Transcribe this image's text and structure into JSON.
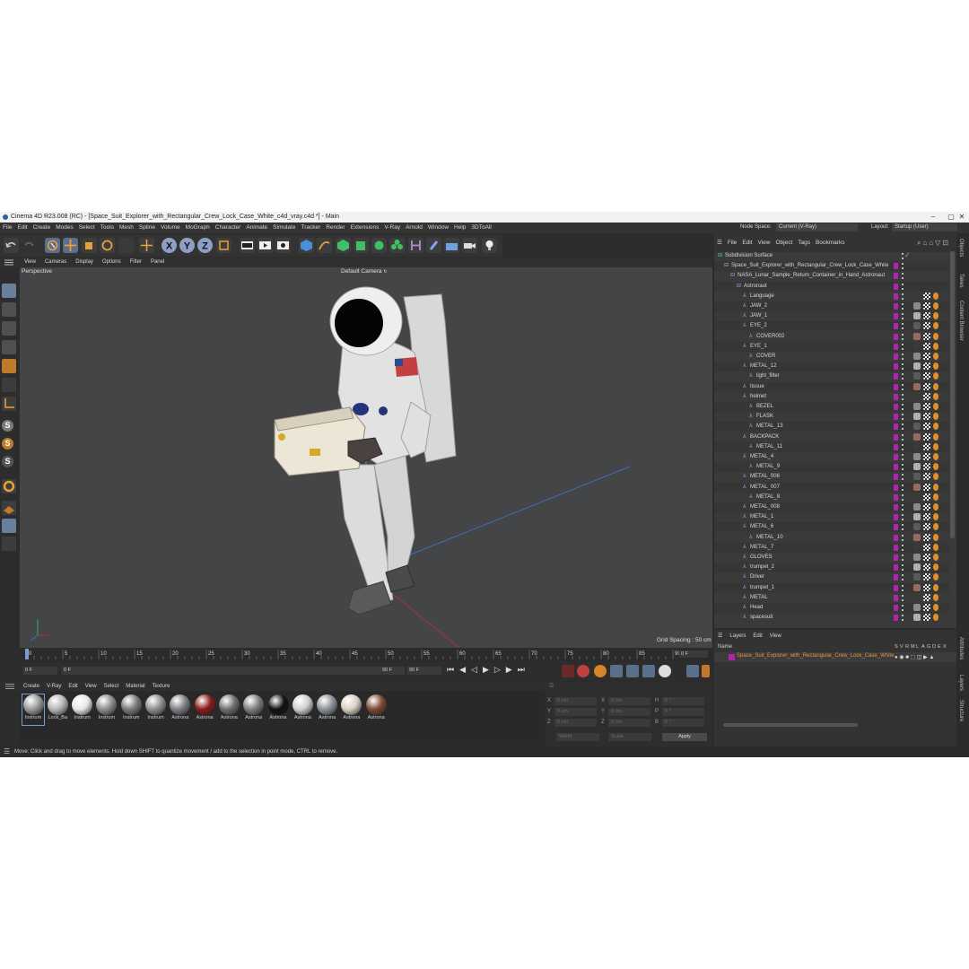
{
  "window": {
    "title": "Cinema 4D R23.008 (RC) - [Space_Suit_Explorer_with_Rectangular_Crew_Lock_Case_White_c4d_vray.c4d *] - Main"
  },
  "menubar": [
    "File",
    "Edit",
    "Create",
    "Modes",
    "Select",
    "Tools",
    "Mesh",
    "Spline",
    "Volume",
    "MoGraph",
    "Character",
    "Animate",
    "Simulate",
    "Tracker",
    "Render",
    "Extensions",
    "V-Ray",
    "Arnold",
    "Window",
    "Help",
    "3DToAll"
  ],
  "node_space": {
    "label": "Node Space:",
    "value": "Current (V-Ray)"
  },
  "layout": {
    "label": "Layout:",
    "value": "Startup (User)"
  },
  "viewport": {
    "menu": [
      "View",
      "Cameras",
      "Display",
      "Options",
      "Filter",
      "Panel"
    ],
    "projection": "Perspective",
    "camera": "Default Camera",
    "grid_spacing": "Grid Spacing : 50 cm"
  },
  "timeline": {
    "ticks": [
      "0",
      "5",
      "10",
      "15",
      "20",
      "25",
      "30",
      "35",
      "40",
      "45",
      "50",
      "55",
      "60",
      "65",
      "70",
      "75",
      "80",
      "85",
      "90"
    ],
    "current_frame": "0 F"
  },
  "playback": {
    "start": "0 F",
    "min": "0 F",
    "max": "90 F",
    "end": "90 F"
  },
  "material_menu": [
    "Create",
    "V-Ray",
    "Edit",
    "View",
    "Select",
    "Material",
    "Texture"
  ],
  "materials": [
    {
      "label": "Instrum",
      "color": "#9a9a9a"
    },
    {
      "label": "Lock_Ba",
      "color": "#b5b5b5"
    },
    {
      "label": "Instrum",
      "color": "#e8e8e8"
    },
    {
      "label": "Instrum",
      "color": "#8c8c8c"
    },
    {
      "label": "Instrum",
      "color": "#7a7a7a"
    },
    {
      "label": "Instrum",
      "color": "#8e8e8e"
    },
    {
      "label": "Astrona",
      "color": "#7d7f84"
    },
    {
      "label": "Astrona",
      "color": "#8b1b1b"
    },
    {
      "label": "Astrona",
      "color": "#6f6f6f"
    },
    {
      "label": "Astrona",
      "color": "#7e7e7e"
    },
    {
      "label": "Astrona",
      "color": "#111111"
    },
    {
      "label": "Astrona",
      "color": "#cfcfcf"
    },
    {
      "label": "Astrona",
      "color": "#8e9299"
    },
    {
      "label": "Astrona",
      "color": "#d8cfc0"
    },
    {
      "label": "Astrona",
      "color": "#7a4a35"
    }
  ],
  "coords": {
    "rows": [
      {
        "a": "X",
        "av": "0 cm",
        "b": "X",
        "bv": "0 cm",
        "c": "H",
        "cv": "0 °"
      },
      {
        "a": "Y",
        "av": "0 cm",
        "b": "Y",
        "bv": "0 cm",
        "c": "P",
        "cv": "0 °"
      },
      {
        "a": "Z",
        "av": "0 cm",
        "b": "Z",
        "bv": "0 cm",
        "c": "B",
        "cv": "0 °"
      }
    ],
    "space": "World",
    "mode": "Scale",
    "apply": "Apply"
  },
  "status": "Move: Click and drag to move elements. Hold down SHIFT to quantize movement / add to the selection in point mode, CTRL to remove.",
  "object_manager": {
    "menu": [
      "File",
      "Edit",
      "View",
      "Object",
      "Tags",
      "Bookmarks"
    ],
    "items": [
      {
        "name": "Subdivision Surface",
        "indent": 0
      },
      {
        "name": "Space_Suit_Explorer_with_Rectangular_Crew_Lock_Case_White",
        "indent": 1
      },
      {
        "name": "NASA_Lunar_Sample_Return_Container_in_Hand_Astronaut",
        "indent": 2
      },
      {
        "name": "Astronaut",
        "indent": 3
      },
      {
        "name": "Language",
        "indent": 4
      },
      {
        "name": "JAW_2",
        "indent": 4
      },
      {
        "name": "JAW_1",
        "indent": 4
      },
      {
        "name": "EYE_2",
        "indent": 4
      },
      {
        "name": "COVER002",
        "indent": 5
      },
      {
        "name": "EYE_1",
        "indent": 4
      },
      {
        "name": "COVER",
        "indent": 5
      },
      {
        "name": "METAL_12",
        "indent": 4
      },
      {
        "name": "light_filter",
        "indent": 5
      },
      {
        "name": "tissue",
        "indent": 4
      },
      {
        "name": "helmet",
        "indent": 4
      },
      {
        "name": "BEZEL",
        "indent": 5
      },
      {
        "name": "FLASK",
        "indent": 5
      },
      {
        "name": "METAL_13",
        "indent": 5
      },
      {
        "name": "BACKPACK",
        "indent": 4
      },
      {
        "name": "METAL_11",
        "indent": 5
      },
      {
        "name": "METAL_4",
        "indent": 4
      },
      {
        "name": "METAL_9",
        "indent": 5
      },
      {
        "name": "METAL_006",
        "indent": 4
      },
      {
        "name": "METAL_007",
        "indent": 4
      },
      {
        "name": "METAL_8",
        "indent": 5
      },
      {
        "name": "METAL_008",
        "indent": 4
      },
      {
        "name": "METAL_1",
        "indent": 4
      },
      {
        "name": "METAL_6",
        "indent": 4
      },
      {
        "name": "METAL_10",
        "indent": 5
      },
      {
        "name": "METAL_7",
        "indent": 4
      },
      {
        "name": "GLOVES",
        "indent": 4
      },
      {
        "name": "trumpet_2",
        "indent": 4
      },
      {
        "name": "Driver",
        "indent": 4
      },
      {
        "name": "trumpet_1",
        "indent": 4
      },
      {
        "name": "METAL",
        "indent": 4
      },
      {
        "name": "Head",
        "indent": 4
      },
      {
        "name": "spacesuit",
        "indent": 4
      }
    ]
  },
  "side_tabs": [
    "Objects",
    "Takes",
    "Content Browser",
    "Attributes",
    "Layers",
    "Structure"
  ],
  "layers_panel": {
    "menu": [
      "Layers",
      "Edit",
      "View"
    ],
    "name_header": "Name",
    "flags": [
      "S",
      "V",
      "R",
      "M",
      "L",
      "A",
      "G",
      "D",
      "E",
      "X"
    ],
    "layer_name": "Space_Suit_Explorer_with_Rectangular_Crew_Lock_Case_White"
  },
  "colors": {
    "accent_blue": "#5a6f8c",
    "layer_magenta": "#b024b0",
    "layer_text_orange": "#e09a3a"
  }
}
